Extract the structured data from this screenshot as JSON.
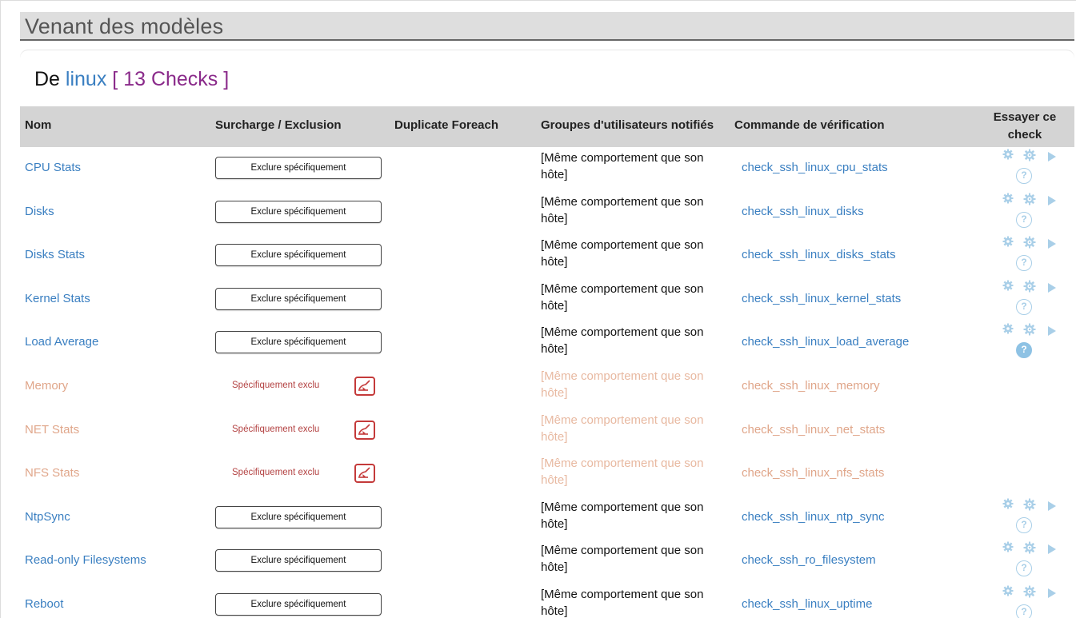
{
  "section": {
    "title": "Venant des modèles"
  },
  "panel": {
    "prefix": "De",
    "host": "linux",
    "count": "[ 13 Checks ]"
  },
  "table": {
    "headers": {
      "name": "Nom",
      "override": "Surcharge / Exclusion",
      "duplicate": "Duplicate Foreach",
      "groups": "Groupes d'utilisateurs notifiés",
      "command": "Commande de vérification",
      "try": "Essayer ce check"
    },
    "exclude_label": "Exclure spécifiquement",
    "excluded_label": "Spécifiquement exclu",
    "same_as_host": "[Même comportement que son hôte]",
    "rows": [
      {
        "name": "CPU Stats",
        "command": "check_ssh_linux_cpu_stats",
        "excluded": false,
        "help_active": false
      },
      {
        "name": "Disks",
        "command": "check_ssh_linux_disks",
        "excluded": false,
        "help_active": false
      },
      {
        "name": "Disks Stats",
        "command": "check_ssh_linux_disks_stats",
        "excluded": false,
        "help_active": false
      },
      {
        "name": "Kernel Stats",
        "command": "check_ssh_linux_kernel_stats",
        "excluded": false,
        "help_active": false
      },
      {
        "name": "Load Average",
        "command": "check_ssh_linux_load_average",
        "excluded": false,
        "help_active": true
      },
      {
        "name": "Memory",
        "command": "check_ssh_linux_memory",
        "excluded": true,
        "help_active": false
      },
      {
        "name": "NET Stats",
        "command": "check_ssh_linux_net_stats",
        "excluded": true,
        "help_active": false
      },
      {
        "name": "NFS Stats",
        "command": "check_ssh_linux_nfs_stats",
        "excluded": true,
        "help_active": false
      },
      {
        "name": "NtpSync",
        "command": "check_ssh_linux_ntp_sync",
        "excluded": false,
        "help_active": false
      },
      {
        "name": "Read-only Filesystems",
        "command": "check_ssh_ro_filesystem",
        "excluded": false,
        "help_active": false
      },
      {
        "name": "Reboot",
        "command": "check_ssh_linux_uptime",
        "excluded": false,
        "help_active": false
      }
    ]
  },
  "icons": {
    "gear": "gear-icon",
    "gear_settings": "gear-settings-icon",
    "play": "play-icon",
    "help": "help-icon",
    "restore": "restore-icon"
  },
  "colors": {
    "link": "#3a7fc1",
    "count": "#8a2a8a",
    "excluded_text": "#e0a68a",
    "excluded_label": "#b34242",
    "icon": "#a9cfe8"
  }
}
